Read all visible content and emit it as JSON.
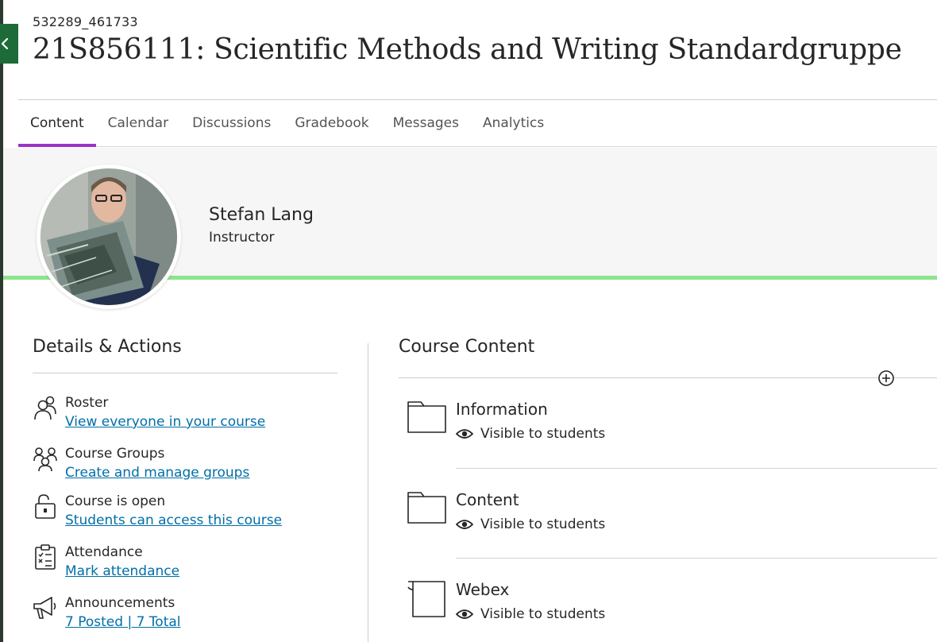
{
  "header": {
    "course_id": "532289_461733",
    "course_title": "21S856111: Scientific Methods and Writing Standardgruppe"
  },
  "tabs": [
    {
      "label": "Content",
      "active": true
    },
    {
      "label": "Calendar"
    },
    {
      "label": "Discussions"
    },
    {
      "label": "Gradebook"
    },
    {
      "label": "Messages"
    },
    {
      "label": "Analytics"
    }
  ],
  "instructor": {
    "name": "Stefan Lang",
    "role": "Instructor"
  },
  "details": {
    "title": "Details & Actions",
    "items": [
      {
        "icon": "roster-icon",
        "title": "Roster",
        "link": "View everyone in your course"
      },
      {
        "icon": "groups-icon",
        "title": "Course Groups",
        "link": "Create and manage groups"
      },
      {
        "icon": "unlock-icon",
        "title": "Course is open",
        "link": "Students can access this course"
      },
      {
        "icon": "attendance-icon",
        "title": "Attendance",
        "link": "Mark attendance"
      },
      {
        "icon": "megaphone-icon",
        "title": "Announcements",
        "link": "7 Posted | 7 Total"
      }
    ]
  },
  "course_content": {
    "title": "Course Content",
    "items": [
      {
        "icon": "folder-icon",
        "title": "Information",
        "visibility": "Visible to students"
      },
      {
        "icon": "folder-icon",
        "title": "Content",
        "visibility": "Visible to students"
      },
      {
        "icon": "document-icon",
        "title": "Webex",
        "visibility": "Visible to students"
      }
    ]
  },
  "colors": {
    "accent_purple": "#9b33c7",
    "banner_line_green": "#8ce58c",
    "link_blue": "#006fa8",
    "close_tab_green": "#1e6b3a"
  }
}
